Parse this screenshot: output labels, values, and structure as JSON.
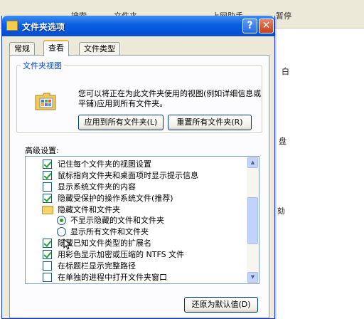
{
  "background": {
    "tools": [
      "搜索",
      "文件夹",
      "上网助手",
      "暂停"
    ],
    "right_chars": [
      "白",
      "盘",
      "劾"
    ]
  },
  "dialog": {
    "title": "文件夹选项",
    "help_label": "?",
    "close_label": "✕",
    "tabs": [
      {
        "label": "常规",
        "active": false
      },
      {
        "label": "查看",
        "active": true
      },
      {
        "label": "文件类型",
        "active": false
      }
    ],
    "folder_views": {
      "legend": "文件夹视图",
      "description": "您可以将正在为此文件夹使用的视图(例如详细信息或平铺)应用到所有文件夹。",
      "apply_button": "应用到所有文件夹(L)",
      "reset_button": "重置所有文件夹(R)"
    },
    "advanced": {
      "label": "高级设置:",
      "items": [
        {
          "type": "checkbox",
          "checked": true,
          "indent": false,
          "label": "记住每个文件夹的视图设置"
        },
        {
          "type": "checkbox",
          "checked": true,
          "indent": false,
          "label": "鼠标指向文件夹和桌面项时显示提示信息"
        },
        {
          "type": "checkbox",
          "checked": false,
          "indent": false,
          "label": "显示系统文件夹的内容"
        },
        {
          "type": "checkbox",
          "checked": true,
          "indent": false,
          "label": "隐藏受保护的操作系统文件(推荐)"
        },
        {
          "type": "folder",
          "checked": false,
          "indent": false,
          "label": "隐藏文件和文件夹"
        },
        {
          "type": "radio",
          "checked": true,
          "indent": true,
          "label": "不显示隐藏的文件和文件夹"
        },
        {
          "type": "radio",
          "checked": false,
          "indent": true,
          "label": "显示所有文件和文件夹"
        },
        {
          "type": "checkbox",
          "checked": true,
          "indent": false,
          "label": "隐藏已知文件类型的扩展名"
        },
        {
          "type": "checkbox",
          "checked": true,
          "indent": false,
          "label": "用彩色显示加密或压缩的 NTFS 文件"
        },
        {
          "type": "checkbox",
          "checked": false,
          "indent": false,
          "label": "在标题栏显示完整路径"
        },
        {
          "type": "checkbox",
          "checked": false,
          "indent": false,
          "label": "在单独的进程中打开文件夹窗口"
        }
      ],
      "scroll_up": "▲",
      "scroll_down": "▼"
    },
    "restore_button": "还原为默认值(D)"
  }
}
